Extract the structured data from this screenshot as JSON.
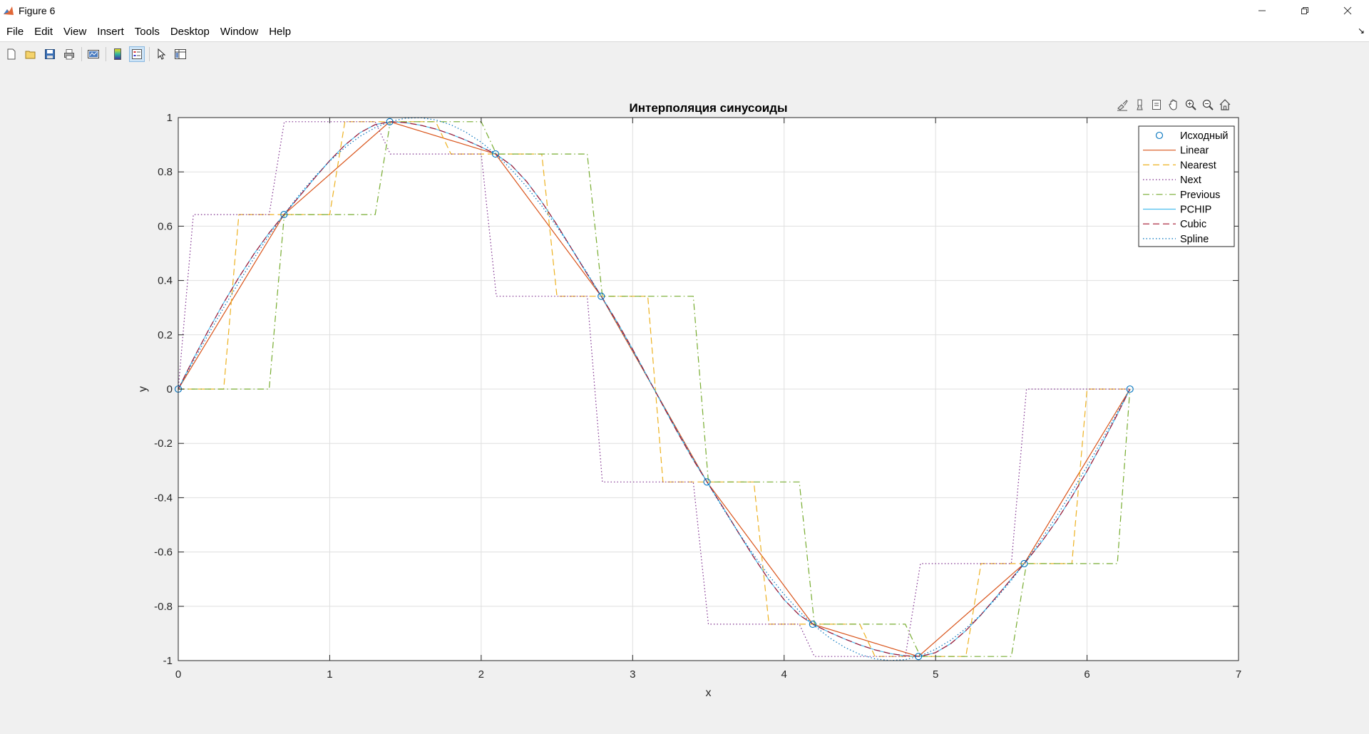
{
  "window": {
    "title": "Figure 6"
  },
  "menu": [
    "File",
    "Edit",
    "View",
    "Insert",
    "Tools",
    "Desktop",
    "Window",
    "Help"
  ],
  "toolbar_icons": [
    "new-figure-icon",
    "open-file-icon",
    "save-icon",
    "print-icon",
    "link-plot-icon",
    "colorbar-icon",
    "legend-icon",
    "pointer-icon",
    "property-inspector-icon"
  ],
  "axes_toolbar_icons": [
    "brush-icon",
    "data-tips-icon",
    "export-icon",
    "pan-icon",
    "zoom-in-icon",
    "zoom-out-icon",
    "home-icon"
  ],
  "colors": {
    "orig": "#0072bd",
    "linear": "#d95319",
    "nearest": "#edb120",
    "next": "#7e2f8e",
    "previous": "#77ac30",
    "pchip": "#4dbeee",
    "cubic": "#a2142f",
    "spline": "#0072bd"
  },
  "chart_data": {
    "type": "line",
    "title": "Интерполяция синусоиды",
    "xlabel": "x",
    "ylabel": "y",
    "xlim": [
      0,
      7
    ],
    "ylim": [
      -1,
      1
    ],
    "xticks": [
      "0",
      "1",
      "2",
      "3",
      "4",
      "5",
      "6",
      "7"
    ],
    "yticks": [
      "-1",
      "-0.8",
      "-0.6",
      "-0.4",
      "-0.2",
      "0",
      "0.2",
      "0.4",
      "0.6",
      "0.8",
      "1"
    ],
    "grid": true,
    "legend_position": "top-right",
    "x": [
      0,
      0.6981,
      1.3963,
      2.0944,
      2.7925,
      3.4907,
      4.1888,
      4.8869,
      5.5851,
      6.2832
    ],
    "y": [
      0,
      0.6428,
      0.9848,
      0.866,
      0.342,
      -0.342,
      -0.866,
      -0.9848,
      -0.6428,
      0
    ],
    "series": [
      {
        "name": "Исходный",
        "method": "markers",
        "style": "circle"
      },
      {
        "name": "Linear",
        "method": "linear",
        "style": "solid"
      },
      {
        "name": "Nearest",
        "method": "nearest",
        "style": "dashed"
      },
      {
        "name": "Next",
        "method": "next",
        "style": "dotted"
      },
      {
        "name": "Previous",
        "method": "previous",
        "style": "dashdot"
      },
      {
        "name": "PCHIP",
        "method": "pchip",
        "style": "solid"
      },
      {
        "name": "Cubic",
        "method": "cubic",
        "style": "dashed"
      },
      {
        "name": "Spline",
        "method": "spline",
        "style": "dotted"
      }
    ]
  }
}
